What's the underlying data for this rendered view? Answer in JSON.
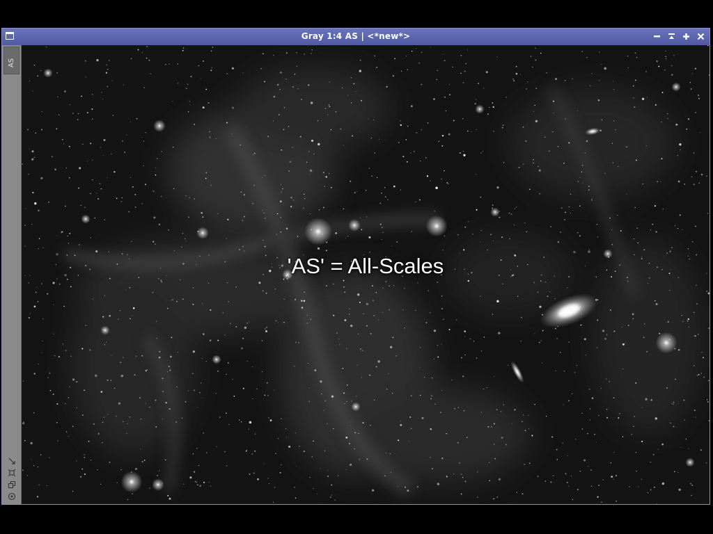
{
  "window": {
    "title": "Gray 1:4 AS | <*new*>",
    "controls": [
      {
        "name": "minimize",
        "icon": "minimize-icon"
      },
      {
        "name": "shade",
        "icon": "shade-icon"
      },
      {
        "name": "maximize",
        "icon": "maximize-icon"
      },
      {
        "name": "close",
        "icon": "close-icon"
      }
    ]
  },
  "sidebar": {
    "tab_label": "AS",
    "tools": [
      {
        "name": "zoom-fit",
        "icon": "zoom-fit-icon"
      },
      {
        "name": "pan",
        "icon": "pan-icon"
      },
      {
        "name": "preview",
        "icon": "preview-icon"
      },
      {
        "name": "target",
        "icon": "target-icon"
      }
    ]
  },
  "image": {
    "overlay_text": "'AS' = All-Scales"
  },
  "colors": {
    "titlebar": "#5560a8",
    "sidebar": "#8a8a8a",
    "background": "#000000"
  }
}
